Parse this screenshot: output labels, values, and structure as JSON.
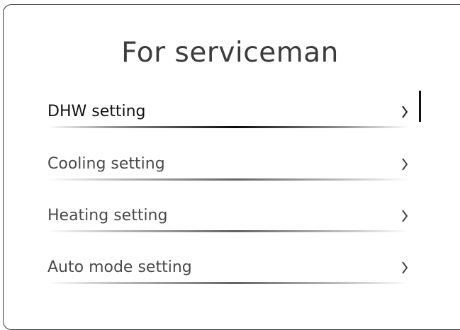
{
  "screen": {
    "title": "For serviceman"
  },
  "menu": {
    "items": [
      {
        "label": "DHW setting",
        "icon": "chevron-right-icon",
        "selected": true
      },
      {
        "label": "Cooling setting",
        "icon": "chevron-right-icon",
        "selected": false
      },
      {
        "label": "Heating setting",
        "icon": "chevron-right-icon",
        "selected": false
      },
      {
        "label": "Auto mode setting",
        "icon": "chevron-right-icon",
        "selected": false
      }
    ]
  },
  "colors": {
    "border": "#3a3a3a",
    "title": "#3c3c3c",
    "selected_text": "#111111",
    "item_text": "#4a4a4a"
  }
}
